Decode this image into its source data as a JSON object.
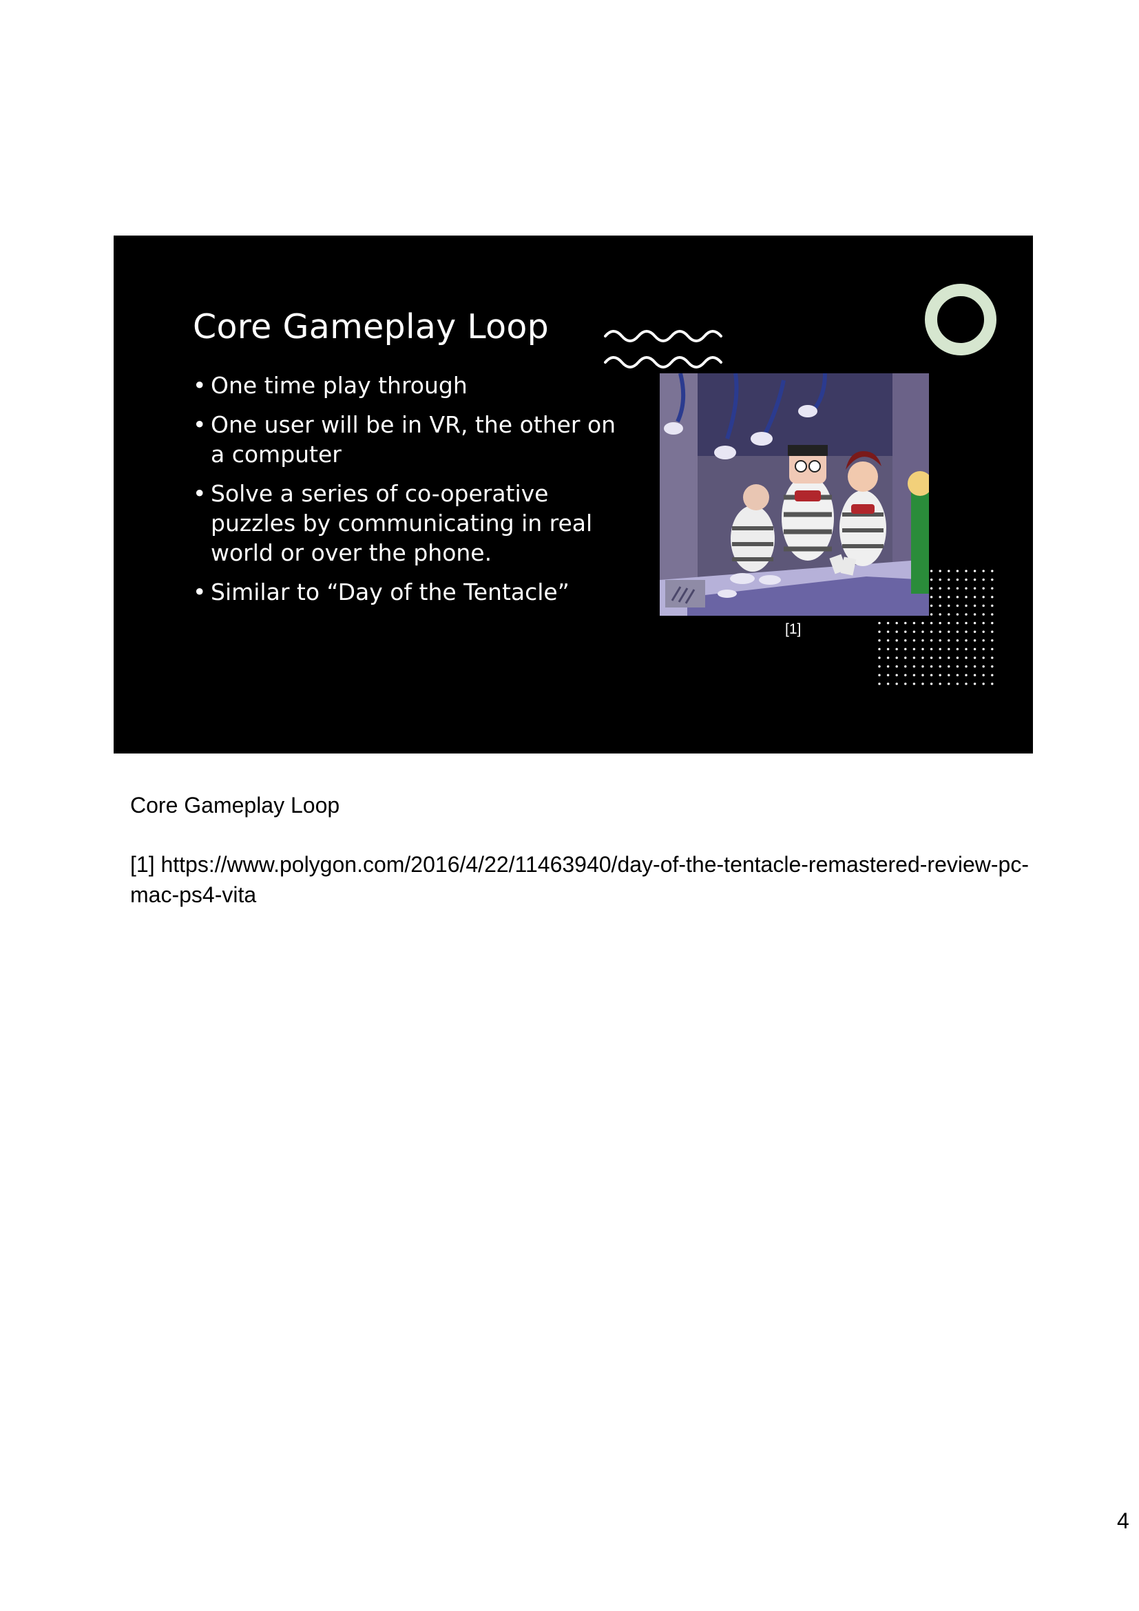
{
  "slide": {
    "title": "Core Gameplay Loop",
    "bullets": [
      "One time play through",
      "One user will be in VR, the other on a computer",
      "Solve a series of co-operative puzzles by communicating in real world or over the phone.",
      "Similar to “Day of the Tentacle”"
    ],
    "image_caption": "[1]",
    "colors": {
      "background": "#000000",
      "ring": "#d6e6cf",
      "text": "#ffffff"
    },
    "icons": [
      "wavy-lines-icon",
      "ring-icon",
      "dot-grid-pattern"
    ]
  },
  "notes": {
    "title": "Core Gameplay Loop",
    "reference": "[1] https://www.polygon.com/2016/4/22/11463940/day-of-the-tentacle-remastered-review-pc-mac-ps4-vita"
  },
  "page_number": "4"
}
